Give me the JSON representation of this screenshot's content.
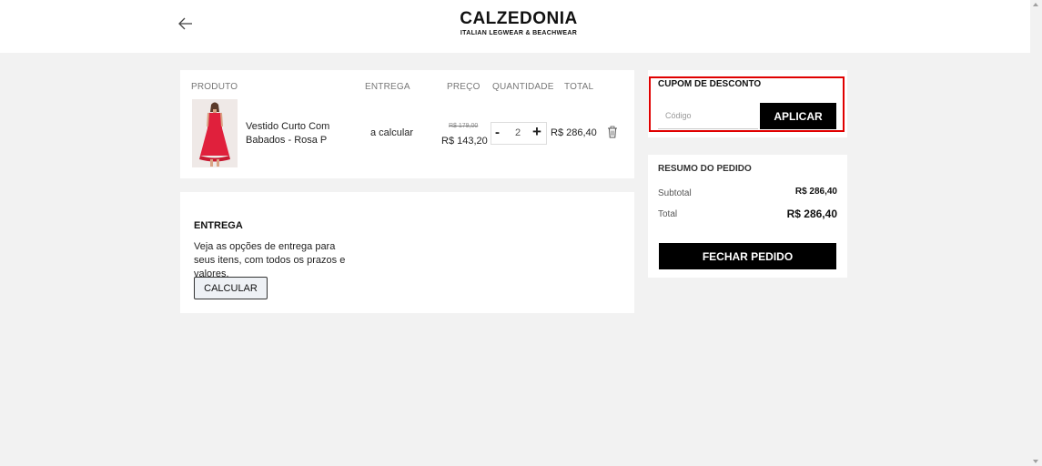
{
  "header": {
    "brand": "CALZEDONIA",
    "tagline": "ITALIAN LEGWEAR & BEACHWEAR",
    "back_icon": "arrow-left-icon"
  },
  "cart": {
    "columns": {
      "product": "PRODUTO",
      "delivery": "ENTREGA",
      "price": "PREÇO",
      "quantity": "QUANTIDADE",
      "total": "TOTAL"
    },
    "items": [
      {
        "name": "Vestido Curto Com Babados - Rosa P",
        "delivery": "a calcular",
        "old_price": "R$ 179,00",
        "price": "R$ 143,20",
        "quantity": "2",
        "total": "R$ 286,40",
        "minus_label": "-",
        "plus_label": "+",
        "remove_icon": "trash-icon"
      }
    ]
  },
  "delivery": {
    "title": "ENTREGA",
    "description": "Veja as opções de entrega para seus itens, com todos os prazos e valores.",
    "button": "CALCULAR"
  },
  "coupon": {
    "title": "CUPOM DE DESCONTO",
    "placeholder": "Código",
    "value": "",
    "button": "APLICAR"
  },
  "summary": {
    "title": "RESUMO DO PEDIDO",
    "subtotal_label": "Subtotal",
    "subtotal_value": "R$ 286,40",
    "total_label": "Total",
    "total_value": "R$ 286,40",
    "checkout_button": "FECHAR PEDIDO"
  },
  "colors": {
    "background": "#f2f2f2",
    "panel": "#ffffff",
    "primary_button": "#000000",
    "highlight": "#e00000",
    "product_dress": "#e0203c"
  }
}
